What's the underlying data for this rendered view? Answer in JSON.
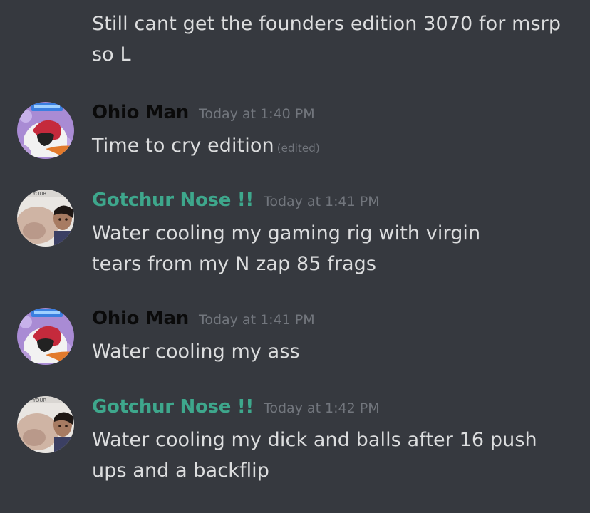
{
  "colors": {
    "background": "#36393f",
    "message_text": "#dcddde",
    "timestamp": "#72767d",
    "ohio_man_name": "#0a0a0a",
    "gotchur_nose_name": "#3ea78c"
  },
  "continuation": {
    "text": "Still cant get the founders edition 3070 for msrp so L"
  },
  "messages": [
    {
      "author": "Ohio Man",
      "timestamp": "Today at 1:40 PM",
      "text": "Time to cry edition",
      "edited": "(edited)",
      "avatar_icon": "ohio-man-avatar"
    },
    {
      "author": "Gotchur Nose !!",
      "timestamp": "Today at 1:41 PM",
      "text": "Water cooling my gaming rig with virgin tears from my N zap 85 frags",
      "avatar_icon": "gotchur-nose-avatar"
    },
    {
      "author": "Ohio Man",
      "timestamp": "Today at 1:41 PM",
      "text": "Water cooling my ass",
      "avatar_icon": "ohio-man-avatar"
    },
    {
      "author": "Gotchur Nose !!",
      "timestamp": "Today at 1:42 PM",
      "text": "Water cooling my dick and balls after 16 push ups and a backflip",
      "avatar_icon": "gotchur-nose-avatar"
    }
  ]
}
